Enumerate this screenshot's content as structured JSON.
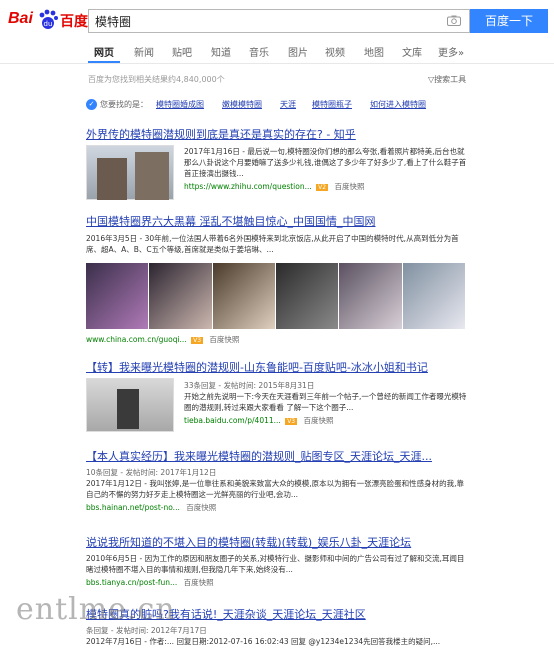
{
  "header": {
    "logo_text": "Bai",
    "logo_cn": "百度",
    "search_value": "模特圈",
    "search_button": "百度一下"
  },
  "nav": {
    "tabs": [
      "网页",
      "新闻",
      "贴吧",
      "知道",
      "音乐",
      "图片",
      "视频",
      "地图",
      "文库",
      "更多»"
    ]
  },
  "meta": {
    "result_count": "百度为您找到相关结果约4,840,000个",
    "tools": "▽搜索工具"
  },
  "recommend": {
    "label": "您要找的是：",
    "items": [
      "模特圈婚成图",
      "嫩模模特圈",
      "天涯",
      "模特圈瓶子",
      "如何进入模特圈"
    ]
  },
  "results": [
    {
      "title": "外界传的模特圈潜规则到底是真还是真实的存在? - 知乎",
      "text": "2017年1月16日 - 最后说一句,模特圈没你们想的那么夸张,看着照片都特美,后台也就那么八卦说这个月要婚嘛了送多少礼钱,谁偶这了多少年了好多少了,看上了什么鞋子首首正接演出摄钱...",
      "url": "https://www.zhihu.com/question...",
      "snap": "百度快照"
    },
    {
      "title": "中国模特圈界六大黑幕 淫乱不堪触目惊心_中国国情_中国网",
      "text": "2016年3月5日 - 30年前,一位法国人带着6名外国模特来到北京饭店,从此开启了中国的模特时代,从高到低分为首席、超A、A、B、C五个等级,首席就是类似于姜培琳、...",
      "url": "www.china.com.cn/guoqi...",
      "snap": "百度快照"
    },
    {
      "title": "【转】我来曝光模特圈的潜规则-山东鲁能吧-百度贴吧-冰冰小姐和书记",
      "meta": "33条回复 - 发帖时间: 2015年8月31日",
      "text": "开始之前先说明一下:今天在天涯看到三年前一个帖子,一个曾经的新闻工作者曝光模特圈的潜规则,转过来跟大家看看 了解一下这个圈子...",
      "url": "tieba.baidu.com/p/4011...",
      "snap": "百度快照"
    },
    {
      "title": "【本人真实经历】我来曝光模特圈的潜规则_贴图专区_天涯论坛_天涯...",
      "meta": "10条回复 - 发帖时间: 2017年1月12日",
      "text": "2017年1月12日 - 我叫张婷,是一位靠往系和美貌来致富大众的模模,原本以为拥有一张漂亮脸蛋和性感身材的我,靠自己的不懈的努力好歹走上模特圈这一光鲜亮丽的行业吧,会功...",
      "url": "bbs.hainan.net/post-no...",
      "snap": "百度快照"
    },
    {
      "title": "说说我所知道的不堪入目的模特圈(转载)(转载)_娱乐八卦_天涯论坛",
      "text": "2010年6月5日 - 因为工作的原因和朋友圈子的关系,对模特行业、摄影师和中间的广告公司有过了解和交流,耳闻目睹过模特圈不堪入目的事情和规则,但我隐几年下来,始终没有...",
      "url": "bbs.tianya.cn/post-fun...",
      "snap": "百度快照"
    },
    {
      "title": "模特圈真的脏吗?我有话说!_天涯杂谈_天涯论坛_天涯社区",
      "meta": "条回复 - 发帖时间: 2012年7月17日",
      "text": "2012年7月16日 - 作者:... 回复日期:2012-07-16 16:02:43 回复 @y1234e1234先回答我楼主的疑问,...",
      "url": "",
      "snap": ""
    }
  ],
  "colors": {
    "link": "#2440b3",
    "highlight": "#cc0000",
    "url": "#008000",
    "button": "#3385ff"
  },
  "watermark": "entlme.cn"
}
